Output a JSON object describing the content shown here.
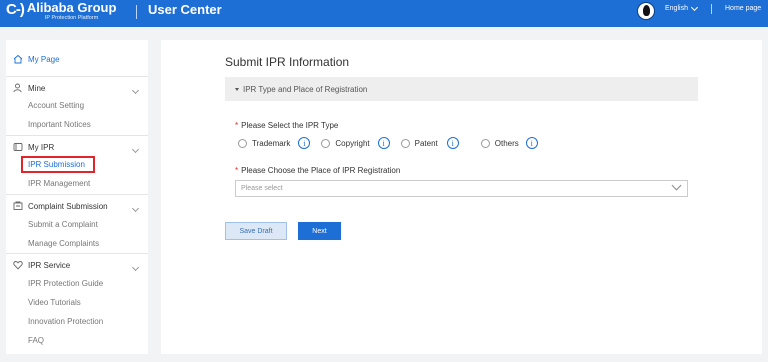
{
  "header": {
    "logo_mark": "C-)",
    "logo_name": "Alibaba Group",
    "logo_sub": "IP Protection Platform",
    "app_title": "User Center",
    "language": "English",
    "home_link": "Home page"
  },
  "sidebar": {
    "my_page": "My Page",
    "sections": {
      "mine": {
        "label": "Mine",
        "items": [
          "Account Setting",
          "Important Notices"
        ]
      },
      "my_ipr": {
        "label": "My IPR",
        "items": [
          "IPR Submission",
          "IPR Management"
        ]
      },
      "complaint": {
        "label": "Complaint Submission",
        "items": [
          "Submit a Complaint",
          "Manage Complaints"
        ]
      },
      "ipr_service": {
        "label": "IPR Service",
        "items": [
          "IPR Protection Guide",
          "Video Tutorials",
          "Innovation Protection",
          "FAQ"
        ]
      }
    },
    "selected_item": "IPR Submission"
  },
  "main": {
    "page_title": "Submit IPR Information",
    "section_title": "IPR Type and Place of Registration",
    "ipr_type": {
      "label": "Please Select the IPR Type",
      "options": [
        "Trademark",
        "Copyright",
        "Patent",
        "Others"
      ]
    },
    "place": {
      "label": "Please Choose the Place of IPR Registration",
      "placeholder": "Please select"
    },
    "buttons": {
      "save_draft": "Save Draft",
      "next": "Next"
    }
  },
  "colors": {
    "brand_blue": "#1d6fd6",
    "required_red": "#e0262c",
    "highlight_red": "#e0262c"
  }
}
